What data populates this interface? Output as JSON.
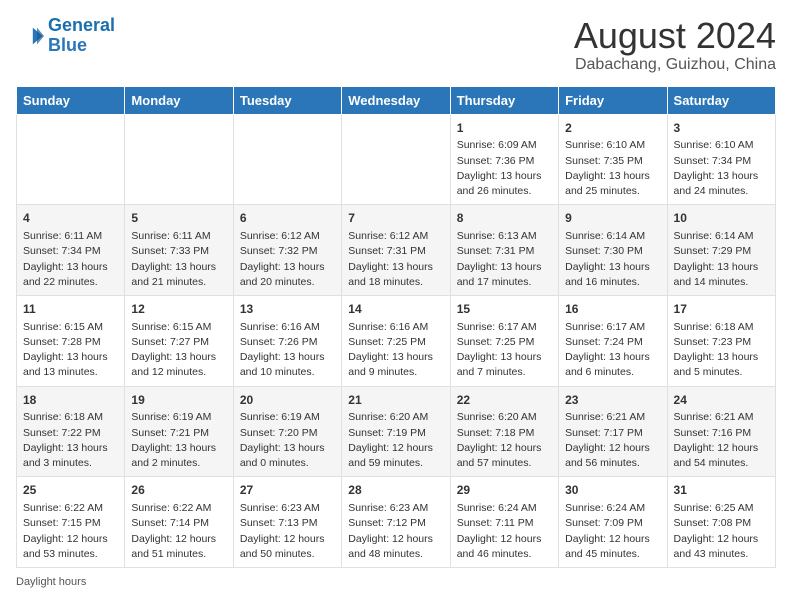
{
  "header": {
    "logo_general": "General",
    "logo_blue": "Blue",
    "month_year": "August 2024",
    "location": "Dabachang, Guizhou, China"
  },
  "days_of_week": [
    "Sunday",
    "Monday",
    "Tuesday",
    "Wednesday",
    "Thursday",
    "Friday",
    "Saturday"
  ],
  "weeks": [
    [
      {
        "day": "",
        "info": ""
      },
      {
        "day": "",
        "info": ""
      },
      {
        "day": "",
        "info": ""
      },
      {
        "day": "",
        "info": ""
      },
      {
        "day": "1",
        "info": "Sunrise: 6:09 AM\nSunset: 7:36 PM\nDaylight: 13 hours and 26 minutes."
      },
      {
        "day": "2",
        "info": "Sunrise: 6:10 AM\nSunset: 7:35 PM\nDaylight: 13 hours and 25 minutes."
      },
      {
        "day": "3",
        "info": "Sunrise: 6:10 AM\nSunset: 7:34 PM\nDaylight: 13 hours and 24 minutes."
      }
    ],
    [
      {
        "day": "4",
        "info": "Sunrise: 6:11 AM\nSunset: 7:34 PM\nDaylight: 13 hours and 22 minutes."
      },
      {
        "day": "5",
        "info": "Sunrise: 6:11 AM\nSunset: 7:33 PM\nDaylight: 13 hours and 21 minutes."
      },
      {
        "day": "6",
        "info": "Sunrise: 6:12 AM\nSunset: 7:32 PM\nDaylight: 13 hours and 20 minutes."
      },
      {
        "day": "7",
        "info": "Sunrise: 6:12 AM\nSunset: 7:31 PM\nDaylight: 13 hours and 18 minutes."
      },
      {
        "day": "8",
        "info": "Sunrise: 6:13 AM\nSunset: 7:31 PM\nDaylight: 13 hours and 17 minutes."
      },
      {
        "day": "9",
        "info": "Sunrise: 6:14 AM\nSunset: 7:30 PM\nDaylight: 13 hours and 16 minutes."
      },
      {
        "day": "10",
        "info": "Sunrise: 6:14 AM\nSunset: 7:29 PM\nDaylight: 13 hours and 14 minutes."
      }
    ],
    [
      {
        "day": "11",
        "info": "Sunrise: 6:15 AM\nSunset: 7:28 PM\nDaylight: 13 hours and 13 minutes."
      },
      {
        "day": "12",
        "info": "Sunrise: 6:15 AM\nSunset: 7:27 PM\nDaylight: 13 hours and 12 minutes."
      },
      {
        "day": "13",
        "info": "Sunrise: 6:16 AM\nSunset: 7:26 PM\nDaylight: 13 hours and 10 minutes."
      },
      {
        "day": "14",
        "info": "Sunrise: 6:16 AM\nSunset: 7:25 PM\nDaylight: 13 hours and 9 minutes."
      },
      {
        "day": "15",
        "info": "Sunrise: 6:17 AM\nSunset: 7:25 PM\nDaylight: 13 hours and 7 minutes."
      },
      {
        "day": "16",
        "info": "Sunrise: 6:17 AM\nSunset: 7:24 PM\nDaylight: 13 hours and 6 minutes."
      },
      {
        "day": "17",
        "info": "Sunrise: 6:18 AM\nSunset: 7:23 PM\nDaylight: 13 hours and 5 minutes."
      }
    ],
    [
      {
        "day": "18",
        "info": "Sunrise: 6:18 AM\nSunset: 7:22 PM\nDaylight: 13 hours and 3 minutes."
      },
      {
        "day": "19",
        "info": "Sunrise: 6:19 AM\nSunset: 7:21 PM\nDaylight: 13 hours and 2 minutes."
      },
      {
        "day": "20",
        "info": "Sunrise: 6:19 AM\nSunset: 7:20 PM\nDaylight: 13 hours and 0 minutes."
      },
      {
        "day": "21",
        "info": "Sunrise: 6:20 AM\nSunset: 7:19 PM\nDaylight: 12 hours and 59 minutes."
      },
      {
        "day": "22",
        "info": "Sunrise: 6:20 AM\nSunset: 7:18 PM\nDaylight: 12 hours and 57 minutes."
      },
      {
        "day": "23",
        "info": "Sunrise: 6:21 AM\nSunset: 7:17 PM\nDaylight: 12 hours and 56 minutes."
      },
      {
        "day": "24",
        "info": "Sunrise: 6:21 AM\nSunset: 7:16 PM\nDaylight: 12 hours and 54 minutes."
      }
    ],
    [
      {
        "day": "25",
        "info": "Sunrise: 6:22 AM\nSunset: 7:15 PM\nDaylight: 12 hours and 53 minutes."
      },
      {
        "day": "26",
        "info": "Sunrise: 6:22 AM\nSunset: 7:14 PM\nDaylight: 12 hours and 51 minutes."
      },
      {
        "day": "27",
        "info": "Sunrise: 6:23 AM\nSunset: 7:13 PM\nDaylight: 12 hours and 50 minutes."
      },
      {
        "day": "28",
        "info": "Sunrise: 6:23 AM\nSunset: 7:12 PM\nDaylight: 12 hours and 48 minutes."
      },
      {
        "day": "29",
        "info": "Sunrise: 6:24 AM\nSunset: 7:11 PM\nDaylight: 12 hours and 46 minutes."
      },
      {
        "day": "30",
        "info": "Sunrise: 6:24 AM\nSunset: 7:09 PM\nDaylight: 12 hours and 45 minutes."
      },
      {
        "day": "31",
        "info": "Sunrise: 6:25 AM\nSunset: 7:08 PM\nDaylight: 12 hours and 43 minutes."
      }
    ]
  ],
  "footer": {
    "note": "Daylight hours"
  }
}
